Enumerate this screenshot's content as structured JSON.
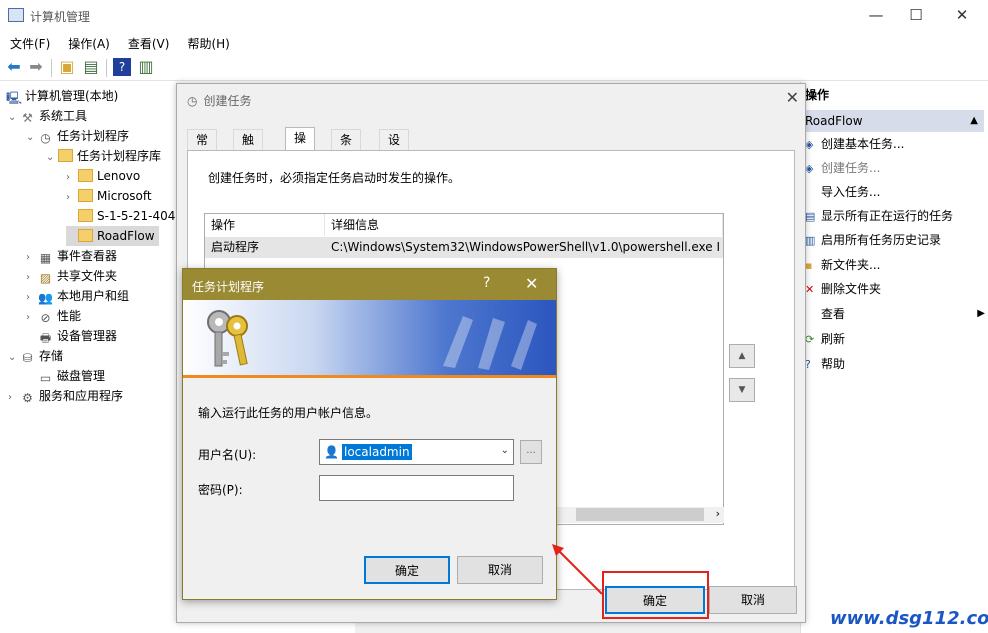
{
  "window": {
    "title": "计算机管理",
    "min": "—",
    "max": "☐",
    "close": "✕"
  },
  "menu": [
    "文件(F)",
    "操作(A)",
    "查看(V)",
    "帮助(H)"
  ],
  "tree": {
    "root": "计算机管理(本地)",
    "system_tools": "系统工具",
    "task_scheduler": "任务计划程序",
    "task_library": "任务计划程序库",
    "lenovo": "Lenovo",
    "microsoft": "Microsoft",
    "sid": "S-1-5-21-404",
    "roadflow": "RoadFlow",
    "event_viewer": "事件查看器",
    "shared_folders": "共享文件夹",
    "local_users": "本地用户和组",
    "performance": "性能",
    "device_manager": "设备管理器",
    "storage": "存储",
    "disk_mgmt": "磁盘管理",
    "services": "服务和应用程序"
  },
  "actions": {
    "header": "操作",
    "section": "RoadFlow",
    "items": [
      "创建基本任务...",
      "创建任务...",
      "导入任务...",
      "显示所有正在运行的任务",
      "启用所有任务历史记录",
      "新文件夹...",
      "删除文件夹",
      "查看",
      "刷新",
      "帮助"
    ]
  },
  "create_task": {
    "title": "创建任务",
    "close": "✕",
    "tabs": [
      "常规",
      "触发器",
      "操作",
      "条件",
      "设置"
    ],
    "description": "创建任务时，必须指定任务启动时发生的操作。",
    "col_action": "操作",
    "col_detail": "详细信息",
    "row_action": "启动程序",
    "row_detail": "C:\\Windows\\System32\\WindowsPowerShell\\v1.0\\powershell.exe Inv",
    "ok": "确定",
    "cancel": "取消"
  },
  "credential": {
    "title": "任务计划程序",
    "help": "?",
    "close": "✕",
    "prompt": "输入运行此任务的用户帐户信息。",
    "user_label": "用户名(U):",
    "user_value": "localadmin",
    "browse": "...",
    "password_label": "密码(P):",
    "ok": "确定",
    "cancel": "取消"
  },
  "watermark": "www.dsg112.com",
  "colors": {
    "credential_title": "#9a8a33",
    "highlight": "#e2231a",
    "selection": "#0078d7"
  }
}
